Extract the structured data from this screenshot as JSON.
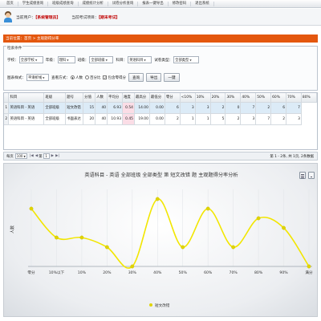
{
  "nav": {
    "items": [
      "首页",
      "学生成绩查询",
      "班级成绩查询",
      "成绩统计分析",
      "试卷分析查询",
      "报表一键导出",
      "修改密码",
      "退出系统"
    ]
  },
  "userbar": {
    "user_label": "当前用户：",
    "user_value": "【系统管理员】",
    "exam_label": "当前考试项目：",
    "exam_value": "【期末考试】"
  },
  "breadcrumb": "当前位置：首页 > 主观题得分率",
  "search": {
    "legend": "检索条件",
    "school_label": "学校：",
    "school_value": "全部学校",
    "grade_label": "年级：",
    "grade_value": "理科",
    "class_label": "班级：",
    "class_value": "全部班级",
    "subject_label": "科目：",
    "subject_value": "英语科目",
    "papertype_label": "试卷类型：",
    "papertype_value": "全部类型",
    "charttype_label": "图表样式：",
    "charttype_value": "平滑折线",
    "viewmode_label": "查看方式：",
    "opt_people": "人数",
    "opt_percent": "百分比",
    "opt_include_zero": "包含零得分",
    "query_button": "查询",
    "export_button": "导出",
    "print_button": "一键"
  },
  "table": {
    "headers": [
      "科目",
      "班级",
      "题号",
      "分值",
      "人数",
      "平均分",
      "难度",
      "最高分",
      "最低分",
      "零分",
      "<10%",
      "10%",
      "20%",
      "30%",
      "40%",
      "50%",
      "60%",
      "70%",
      "80%"
    ],
    "rows": [
      [
        "1",
        "英语科目 - 英语",
        "全部班级",
        "短文改错",
        "15",
        "40",
        "6.93",
        "0.54",
        "14.00",
        "0.00",
        "6",
        "3",
        "3",
        "2",
        "0",
        "7",
        "2",
        "6",
        "7"
      ],
      [
        "2",
        "英语科目 - 英语",
        "全部班级",
        "书面表达",
        "20",
        "40",
        "10.93",
        "0.45",
        "19.00",
        "0.00",
        "2",
        "1",
        "1",
        "5",
        "2",
        "3",
        "7",
        "2",
        "3"
      ]
    ]
  },
  "pager": {
    "page_size_label": "每页",
    "page_size": "100",
    "first": "|◀",
    "prev": "◀",
    "page_label": "第",
    "page_value": "1",
    "next": "▶",
    "last": "▶|",
    "info": "第 1 - 2条, 共 1页, 2条数据"
  },
  "chart_data": {
    "type": "line",
    "title": "英语科目 - 英语 全部班级 全部类型 第 短文改错 题 主观题得分率分析",
    "xlabel": "",
    "ylabel": "人数",
    "categories": [
      "零分",
      "10%以下",
      "10%",
      "20%",
      "30%",
      "40%",
      "50%",
      "60%",
      "70%",
      "80%",
      "90%",
      "满分"
    ],
    "series": [
      {
        "name": "短文改错",
        "values": [
          6,
          3,
          3,
          2,
          0,
          7,
          2,
          6,
          2,
          5,
          4,
          0
        ]
      }
    ],
    "ylim": [
      0,
      8
    ],
    "grid": true,
    "legend": "bottom",
    "line_color": "#f2e600",
    "marker_color": "#e0d400"
  }
}
